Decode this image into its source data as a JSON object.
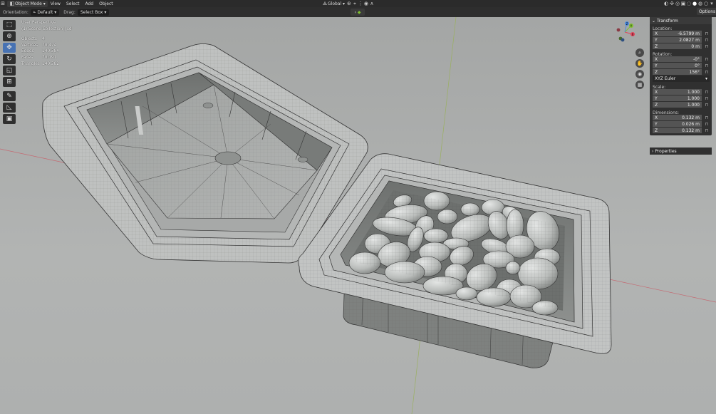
{
  "header": {
    "mode": "Object Mode",
    "menus": [
      "View",
      "Select",
      "Add",
      "Object"
    ],
    "transform_orientation": "Global"
  },
  "tool_settings": {
    "orientation_label": "Orientation:",
    "orientation_value": "Default",
    "drag_label": "Drag:",
    "drag_value": "Select Box",
    "options_label": "Options"
  },
  "viewport": {
    "perspective": "User Perspective",
    "collection": "(1) Scene Collection | sd",
    "stats": [
      {
        "key": "Objects",
        "value": "4"
      },
      {
        "key": "Vertices",
        "value": "70,474"
      },
      {
        "key": "Edges",
        "value": "140,384"
      },
      {
        "key": "Faces",
        "value": "70,191"
      },
      {
        "key": "Triangles",
        "value": "140,382"
      }
    ]
  },
  "gizmo": {
    "x": "X",
    "y": "Y",
    "z": "Z"
  },
  "transform_panel": {
    "title": "Transform",
    "location_label": "Location:",
    "location": [
      {
        "axis": "X",
        "value": "-6.5799 m"
      },
      {
        "axis": "Y",
        "value": "2.0827 m"
      },
      {
        "axis": "Z",
        "value": "0 m"
      }
    ],
    "rotation_label": "Rotation:",
    "rotation": [
      {
        "axis": "X",
        "value": "-0°"
      },
      {
        "axis": "Y",
        "value": "0°"
      },
      {
        "axis": "Z",
        "value": "156°"
      }
    ],
    "rotation_mode": "XYZ Euler",
    "scale_label": "Scale:",
    "scale": [
      {
        "axis": "X",
        "value": "1.000"
      },
      {
        "axis": "Y",
        "value": "1.000"
      },
      {
        "axis": "Z",
        "value": "1.000"
      }
    ],
    "dimensions_label": "Dimensions:",
    "dimensions": [
      {
        "axis": "X",
        "value": "0.132 m"
      },
      {
        "axis": "Y",
        "value": "0.026 m"
      },
      {
        "axis": "Z",
        "value": "0.132 m"
      }
    ]
  },
  "properties_panel": {
    "title": "Properties"
  },
  "colors": {
    "header_bg": "#2b2b2b",
    "active_tool": "#4772b3",
    "viewport_bg": "#a8aaa9",
    "axis_x": "#e0445a",
    "axis_y": "#7fbe30",
    "axis_z": "#4a8ae0"
  }
}
